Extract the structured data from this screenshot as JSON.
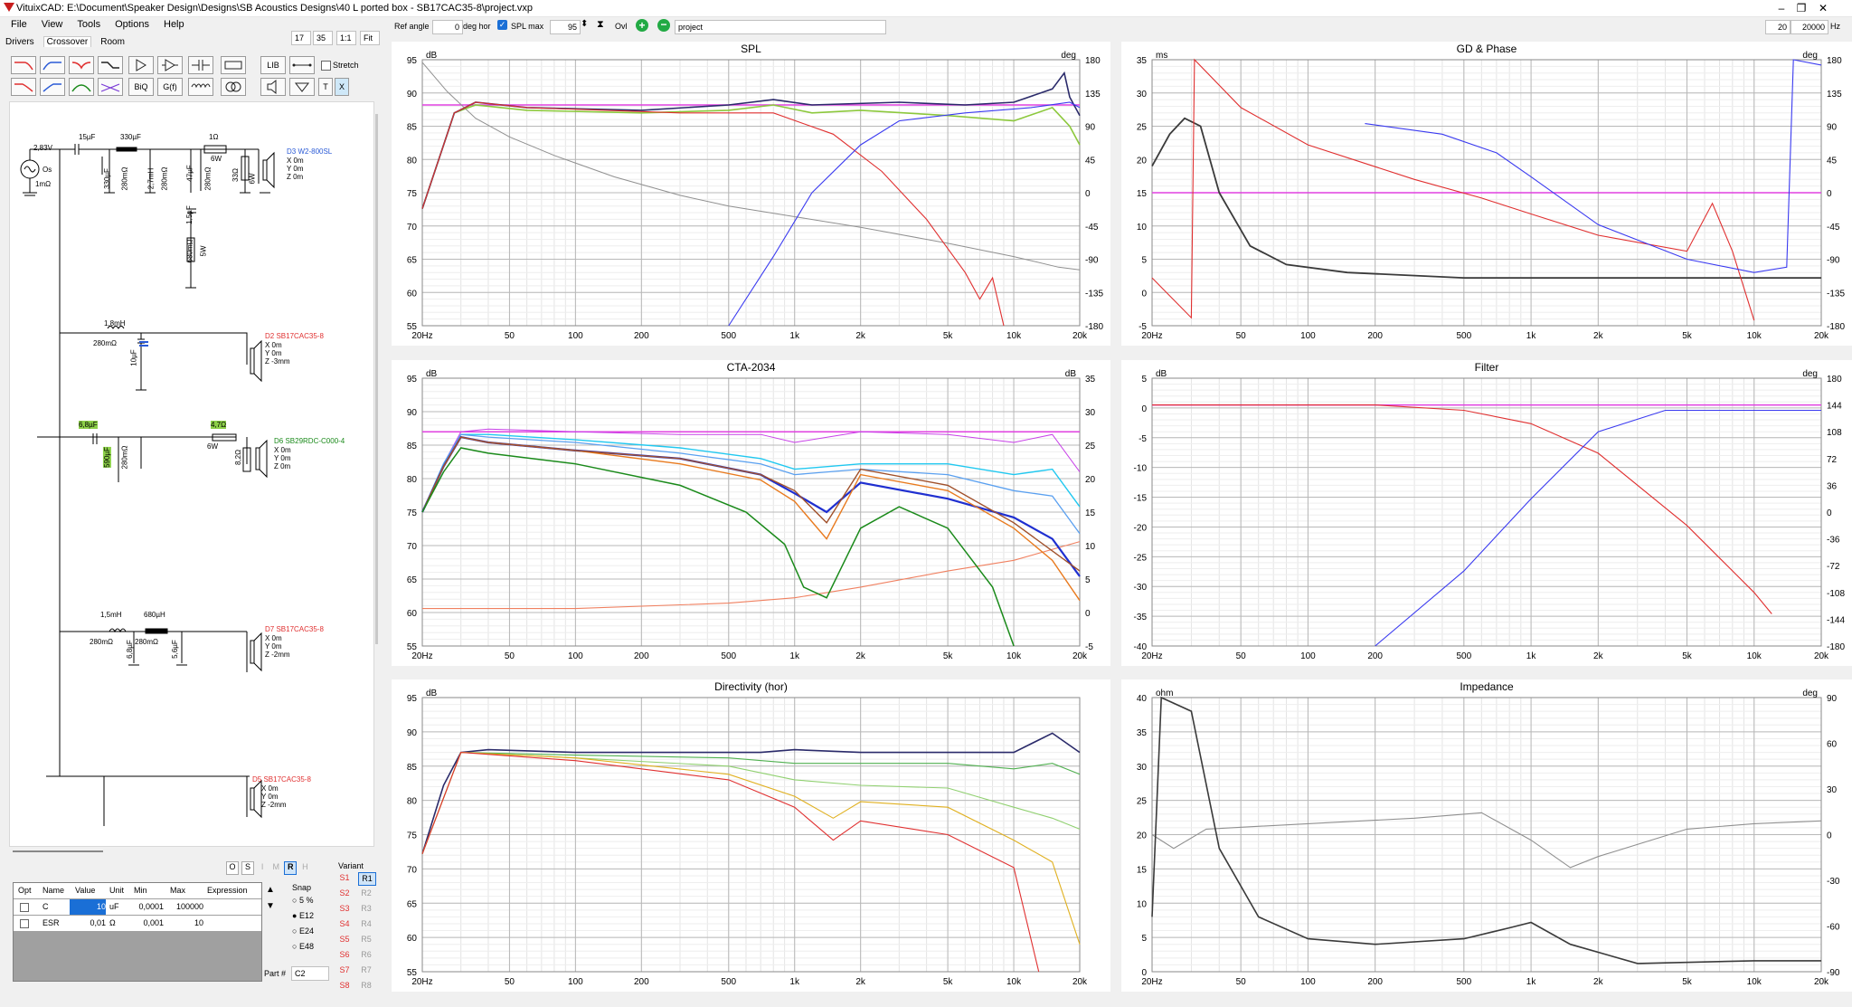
{
  "window": {
    "title": "VituixCAD: E:\\Document\\Speaker Design\\Designs\\SB Acoustics Designs\\40 L ported box - SB17CAC35-8\\project.vxp",
    "min": "–",
    "max": "❐",
    "close": "✕"
  },
  "menu": [
    "File",
    "View",
    "Tools",
    "Options",
    "Help"
  ],
  "tabs": [
    "Drivers",
    "Crossover",
    "Room"
  ],
  "toolbar": {
    "zoom1": "17",
    "zoom2": "35",
    "ratio": "1:1",
    "fit": "Fit",
    "ref_angle_label": "Ref angle",
    "ref_angle_value": "0",
    "deg_hor": "deg hor",
    "spl_max_label": "SPL max",
    "spl_max_value": "95",
    "ovl_label": "Ovl",
    "project_name": "project",
    "fmin": "20",
    "fmax": "20000",
    "hz": "Hz"
  },
  "tool_buttons": {
    "lib": "LIB",
    "biq": "BiQ",
    "gf": "G(f)",
    "t": "T",
    "x": "X",
    "stretch": "Stretch"
  },
  "schematic": {
    "source": {
      "voltage": "2,83V",
      "name": "Os",
      "res": "1mΩ"
    },
    "drivers": [
      {
        "id": "D3 W2-800SL",
        "x": "X 0m",
        "y": "Y 0m",
        "z": "Z 0m"
      },
      {
        "id": "D2 SB17CAC35-8",
        "x": "X 0m",
        "y": "Y 0m",
        "z": "Z -3mm"
      },
      {
        "id": "D6 SB29RDC-C000-4",
        "x": "X 0m",
        "y": "Y 0m",
        "z": "Z 0m"
      },
      {
        "id": "D7 SB17CAC35-8",
        "x": "X 0m",
        "y": "Y 0m",
        "z": "Z -2mm"
      },
      {
        "id": "D5 SB17CAC35-8",
        "x": "X 0m",
        "y": "Y 0m",
        "z": "Z -2mm"
      }
    ],
    "labels": {
      "c15": "15µF",
      "l330": "330µF",
      "r1": "1Ω",
      "w6a": "6W",
      "c330": "330µF",
      "r280a": "280mΩ",
      "l27": "2,7mH",
      "r280b": "280mΩ",
      "c47": "47µF",
      "r280c": "280mΩ",
      "r33": "33Ω",
      "w6b": "6W",
      "c15b": "1,5µF",
      "r680": "680mΩ",
      "w5": "5W",
      "l18": "1,8mH",
      "r280d": "280mΩ",
      "c10": "10µF",
      "c68": "6,8µF",
      "r47": "4,7Ω",
      "w6c": "6W",
      "c590": "590µF",
      "r280e": "280mΩ",
      "r82": "8,2Ω",
      "l15": "1,5mH",
      "l680": "680µH",
      "r280f": "280mΩ",
      "r280g": "280mΩ",
      "c68b": "6,8µF",
      "c56": "5,6µF"
    }
  },
  "bottom": {
    "mode_buttons": [
      "O",
      "S",
      "I",
      "M",
      "R",
      "H"
    ],
    "table_headers": [
      "Opt",
      "Name",
      "Value",
      "Unit",
      "Min",
      "Max",
      "Expression"
    ],
    "rows": [
      {
        "name": "C",
        "value": "10",
        "unit": "uF",
        "min": "0,0001",
        "max": "100000"
      },
      {
        "name": "ESR",
        "value": "0,01",
        "unit": "Ω",
        "min": "0,001",
        "max": "10"
      }
    ],
    "snap_label": "Snap",
    "snap_options": [
      "5 %",
      "E12",
      "E24",
      "E48"
    ],
    "part_label": "Part #",
    "part_value": "C2",
    "variant_label": "Variant",
    "s_variants": [
      "S1",
      "S2",
      "S3",
      "S4",
      "S5",
      "S6",
      "S7",
      "S8"
    ],
    "r_variants": [
      "R1",
      "R2",
      "R3",
      "R4",
      "R5",
      "R6",
      "R7",
      "R8"
    ]
  },
  "graphs": {
    "spl": {
      "title": "SPL",
      "yl_unit": "dB",
      "yr_unit": "deg",
      "yl": [
        "95",
        "90",
        "85",
        "80",
        "75",
        "70",
        "65",
        "60",
        "55"
      ],
      "yr": [
        "180",
        "135",
        "90",
        "45",
        "0",
        "-45",
        "-90",
        "-135",
        "-180"
      ],
      "x": [
        "20Hz",
        "50",
        "100",
        "200",
        "500",
        "1k",
        "2k",
        "5k",
        "10k",
        "20k"
      ]
    },
    "gd": {
      "title": "GD & Phase",
      "yl_unit": "ms",
      "yr_unit": "deg",
      "yl": [
        "35",
        "30",
        "25",
        "20",
        "15",
        "10",
        "5",
        "0",
        "-5"
      ],
      "yr": [
        "180",
        "135",
        "90",
        "45",
        "0",
        "-45",
        "-90",
        "-135",
        "-180"
      ],
      "x": [
        "20Hz",
        "50",
        "100",
        "200",
        "500",
        "1k",
        "2k",
        "5k",
        "10k",
        "20k"
      ]
    },
    "cta": {
      "title": "CTA-2034",
      "yl_unit": "dB",
      "yr_unit": "dB",
      "yl": [
        "95",
        "90",
        "85",
        "80",
        "75",
        "70",
        "65",
        "60",
        "55"
      ],
      "yr": [
        "35",
        "30",
        "25",
        "20",
        "15",
        "10",
        "5",
        "0",
        "-5"
      ],
      "x": [
        "20Hz",
        "50",
        "100",
        "200",
        "500",
        "1k",
        "2k",
        "5k",
        "10k",
        "20k"
      ]
    },
    "filter": {
      "title": "Filter",
      "yl_unit": "dB",
      "yr_unit": "deg",
      "yl": [
        "5",
        "0",
        "-5",
        "-10",
        "-15",
        "-20",
        "-25",
        "-30",
        "-35",
        "-40"
      ],
      "yr": [
        "180",
        "144",
        "108",
        "72",
        "36",
        "0",
        "-36",
        "-72",
        "-108",
        "-144",
        "-180"
      ],
      "x": [
        "20Hz",
        "50",
        "100",
        "200",
        "500",
        "1k",
        "2k",
        "5k",
        "10k",
        "20k"
      ]
    },
    "dir": {
      "title": "Directivity (hor)",
      "yl_unit": "dB",
      "yr_unit": "",
      "yl": [
        "95",
        "90",
        "85",
        "80",
        "75",
        "70",
        "65",
        "60",
        "55"
      ],
      "yr": [],
      "x": [
        "20Hz",
        "50",
        "100",
        "200",
        "500",
        "1k",
        "2k",
        "5k",
        "10k",
        "20k"
      ]
    },
    "imp": {
      "title": "Impedance",
      "yl_unit": "ohm",
      "yr_unit": "deg",
      "yl": [
        "40",
        "35",
        "30",
        "25",
        "20",
        "15",
        "10",
        "5",
        "0"
      ],
      "yr": [
        "90",
        "60",
        "30",
        "0",
        "-30",
        "-60",
        "-90"
      ],
      "x": [
        "20Hz",
        "50",
        "100",
        "200",
        "500",
        "1k",
        "2k",
        "5k",
        "10k",
        "20k"
      ]
    }
  },
  "colors": {
    "magenta": "#e040e0",
    "dark": "#3c3c3c",
    "blue": "#3a3af0",
    "red": "#e03030",
    "green": "#1a8a1a",
    "olive": "#8cc83c",
    "brown": "#a0502a",
    "cyan": "#20c8f0",
    "orange": "#e87a1e",
    "lightblue": "#5aa0f0"
  }
}
